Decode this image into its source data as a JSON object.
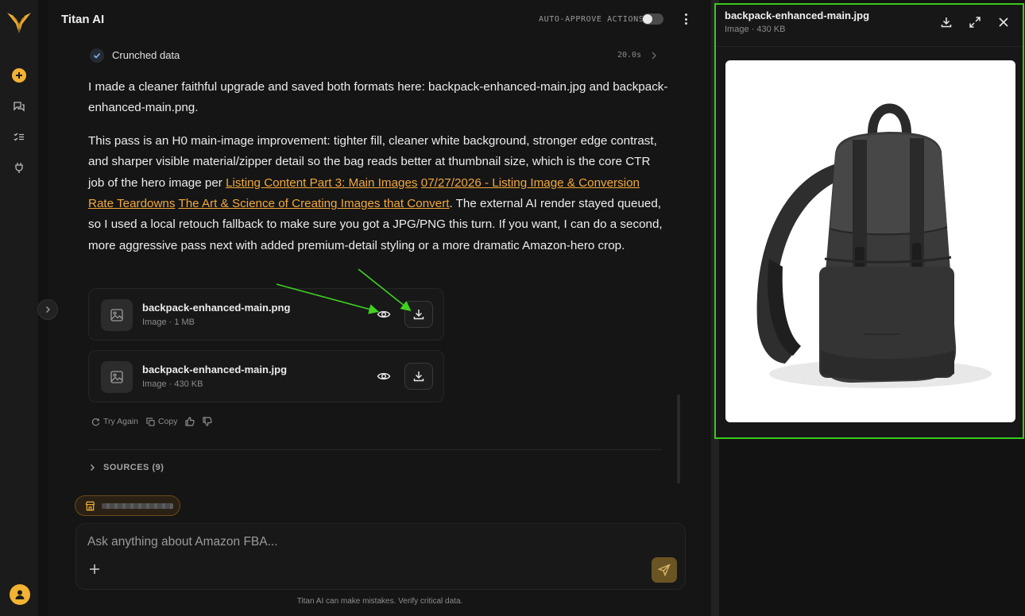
{
  "app": {
    "title": "Titan AI"
  },
  "header": {
    "auto_approve_label": "AUTO-APPROVE ACTIONS",
    "auto_approve_on": false
  },
  "step": {
    "label": "Crunched data",
    "duration": "20.0s"
  },
  "message": {
    "p1": "I made a cleaner faithful upgrade and saved both formats here: backpack-enhanced-main.jpg and backpack-enhanced-main.png.",
    "p2_before": "This pass is an H0 main-image improvement: tighter fill, cleaner white background, stronger edge contrast, and sharper visible material/zipper detail so the bag reads better at thumbnail size, which is the core CTR job of the hero image per ",
    "link1": "Listing Content Part 3: Main Images",
    "link2": "07/27/2026 - Listing Image & Conversion Rate Teardowns",
    "link3": "The Art & Science of Creating Images that Convert",
    "p2_after": ". The external AI render stayed queued, so I used a local retouch fallback to make sure you got a JPG/PNG this turn. If you want, I can do a second, more aggressive pass next with added premium-detail styling or a more dramatic Amazon-hero crop."
  },
  "files": [
    {
      "name": "backpack-enhanced-main.png",
      "meta": "Image · 1 MB"
    },
    {
      "name": "backpack-enhanced-main.jpg",
      "meta": "Image · 430 KB"
    }
  ],
  "actions": {
    "try_again": "Try Again",
    "copy": "Copy"
  },
  "sources": {
    "label": "SOURCES (9)"
  },
  "composer": {
    "placeholder": "Ask anything about Amazon FBA..."
  },
  "disclaimer": "Titan AI can make mistakes. Verify critical data.",
  "preview": {
    "title": "backpack-enhanced-main.jpg",
    "meta": "Image · 430 KB"
  },
  "colors": {
    "accent": "#f2b233",
    "link": "#f2a93b",
    "highlight": "#39c91e",
    "annotation_arrow": "#3fd21f"
  },
  "icons": [
    "logo-icon",
    "new-chat-icon",
    "chats-icon",
    "tasks-icon",
    "plug-icon",
    "user-icon",
    "kebab-icon",
    "check-icon",
    "chevron-right-icon",
    "image-icon",
    "eye-icon",
    "download-icon",
    "refresh-icon",
    "copy-icon",
    "thumbs-up-icon",
    "thumbs-down-icon",
    "chevron-right-icon",
    "store-icon",
    "plus-icon",
    "send-icon",
    "expand-icon",
    "close-icon"
  ]
}
